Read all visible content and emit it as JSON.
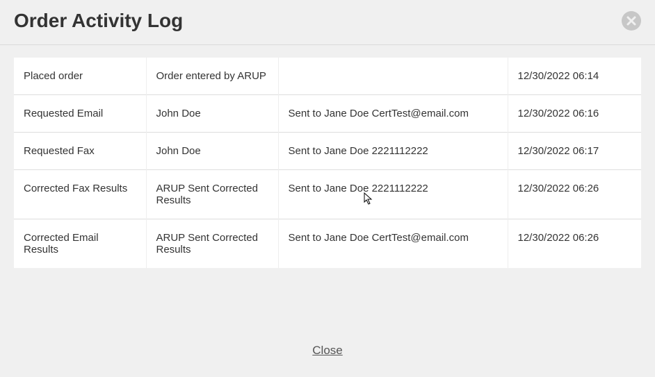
{
  "header": {
    "title": "Order Activity Log"
  },
  "footer": {
    "close_label": "Close"
  },
  "rows": [
    {
      "action": "Placed order",
      "by": "Order entered by ARUP",
      "detail": "",
      "time": "12/30/2022 06:14"
    },
    {
      "action": "Requested Email",
      "by": "John Doe",
      "detail": "Sent to Jane Doe CertTest@email.com",
      "time": "12/30/2022 06:16"
    },
    {
      "action": "Requested Fax",
      "by": "John Doe",
      "detail": "Sent to Jane Doe 2221112222",
      "time": "12/30/2022 06:17"
    },
    {
      "action": "Corrected Fax Results",
      "by": "ARUP Sent Corrected Results",
      "detail": "Sent to Jane Doe 2221112222",
      "time": "12/30/2022 06:26"
    },
    {
      "action": "Corrected Email Results",
      "by": "ARUP Sent Corrected Results",
      "detail": "Sent to Jane Doe CertTest@email.com",
      "time": "12/30/2022 06:26"
    }
  ]
}
